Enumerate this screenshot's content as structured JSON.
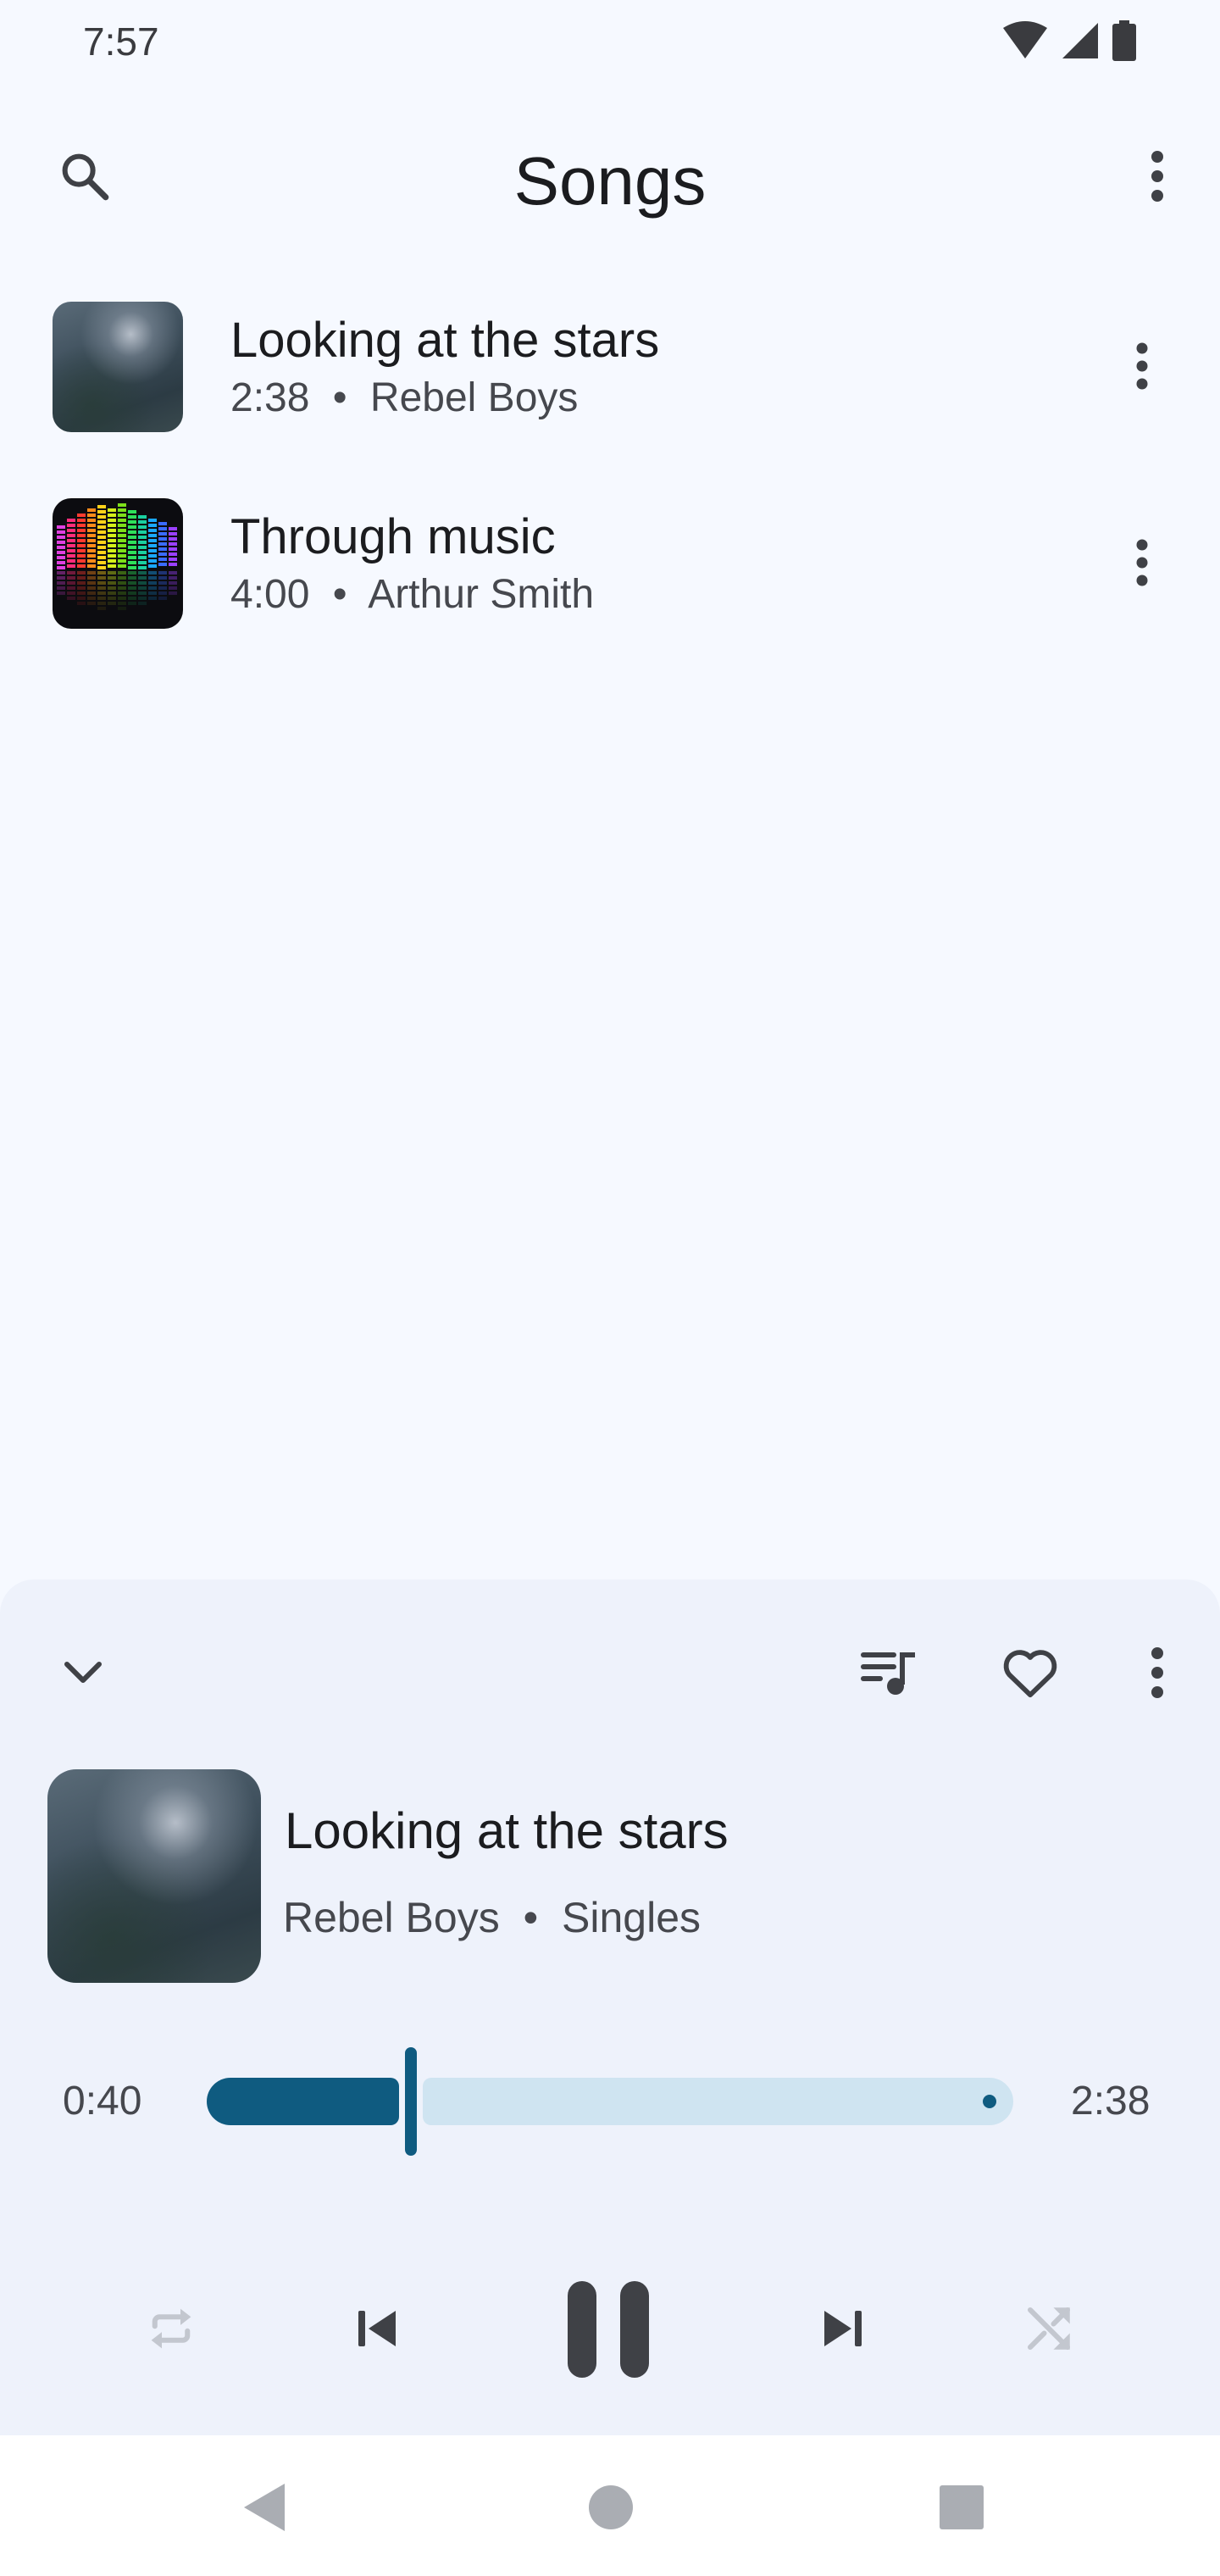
{
  "status_bar": {
    "time": "7:57",
    "icons": [
      "wifi-icon",
      "signal-icon",
      "battery-icon"
    ]
  },
  "top_app_bar": {
    "title": "Songs",
    "search_icon": "search-icon",
    "more_icon": "more-vert-icon"
  },
  "songs": [
    {
      "title": "Looking at the stars",
      "duration": "2:38",
      "separator": "•",
      "artist": "Rebel Boys",
      "art": "starry-sky-artwork"
    },
    {
      "title": "Through music",
      "duration": "4:00",
      "separator": "•",
      "artist": "Arthur Smith",
      "art": "equalizer-artwork"
    }
  ],
  "player": {
    "title": "Looking at the stars",
    "artist": "Rebel Boys",
    "separator": "•",
    "album": "Singles",
    "elapsed": "0:40",
    "total": "2:38",
    "progress": 0.253,
    "state": "playing",
    "repeat_enabled": false,
    "shuffle_enabled": false,
    "icons": {
      "collapse": "chevron-down-icon",
      "queue": "queue-music-icon",
      "favorite": "heart-outline-icon",
      "more": "more-vert-icon",
      "repeat": "repeat-icon",
      "previous": "skip-previous-icon",
      "pause": "pause-icon",
      "next": "skip-next-icon",
      "shuffle": "shuffle-icon"
    }
  },
  "nav_bar": {
    "icons": [
      "back-icon",
      "home-icon",
      "recents-icon"
    ]
  },
  "colors": {
    "background": "#f6f9ff",
    "panel": "#eef2fb",
    "accent": "#0f5b80",
    "track_inactive": "#cfe4f1",
    "icon": "#3f4146",
    "icon_disabled": "#c3c7cf"
  }
}
